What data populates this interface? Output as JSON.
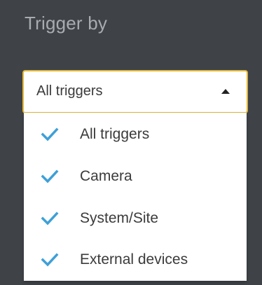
{
  "panel": {
    "title": "Trigger by"
  },
  "dropdown": {
    "selected": "All triggers",
    "expanded": true,
    "caret_icon": "caret-up-icon",
    "options": [
      {
        "label": "All triggers",
        "checked": true
      },
      {
        "label": "Camera",
        "checked": true
      },
      {
        "label": "System/Site",
        "checked": true
      },
      {
        "label": "External devices",
        "checked": true
      }
    ]
  },
  "colors": {
    "background": "#3f4347",
    "title_text": "#a8acb0",
    "focus_border": "#e2b93b",
    "check_accent": "#3ea0d8"
  }
}
